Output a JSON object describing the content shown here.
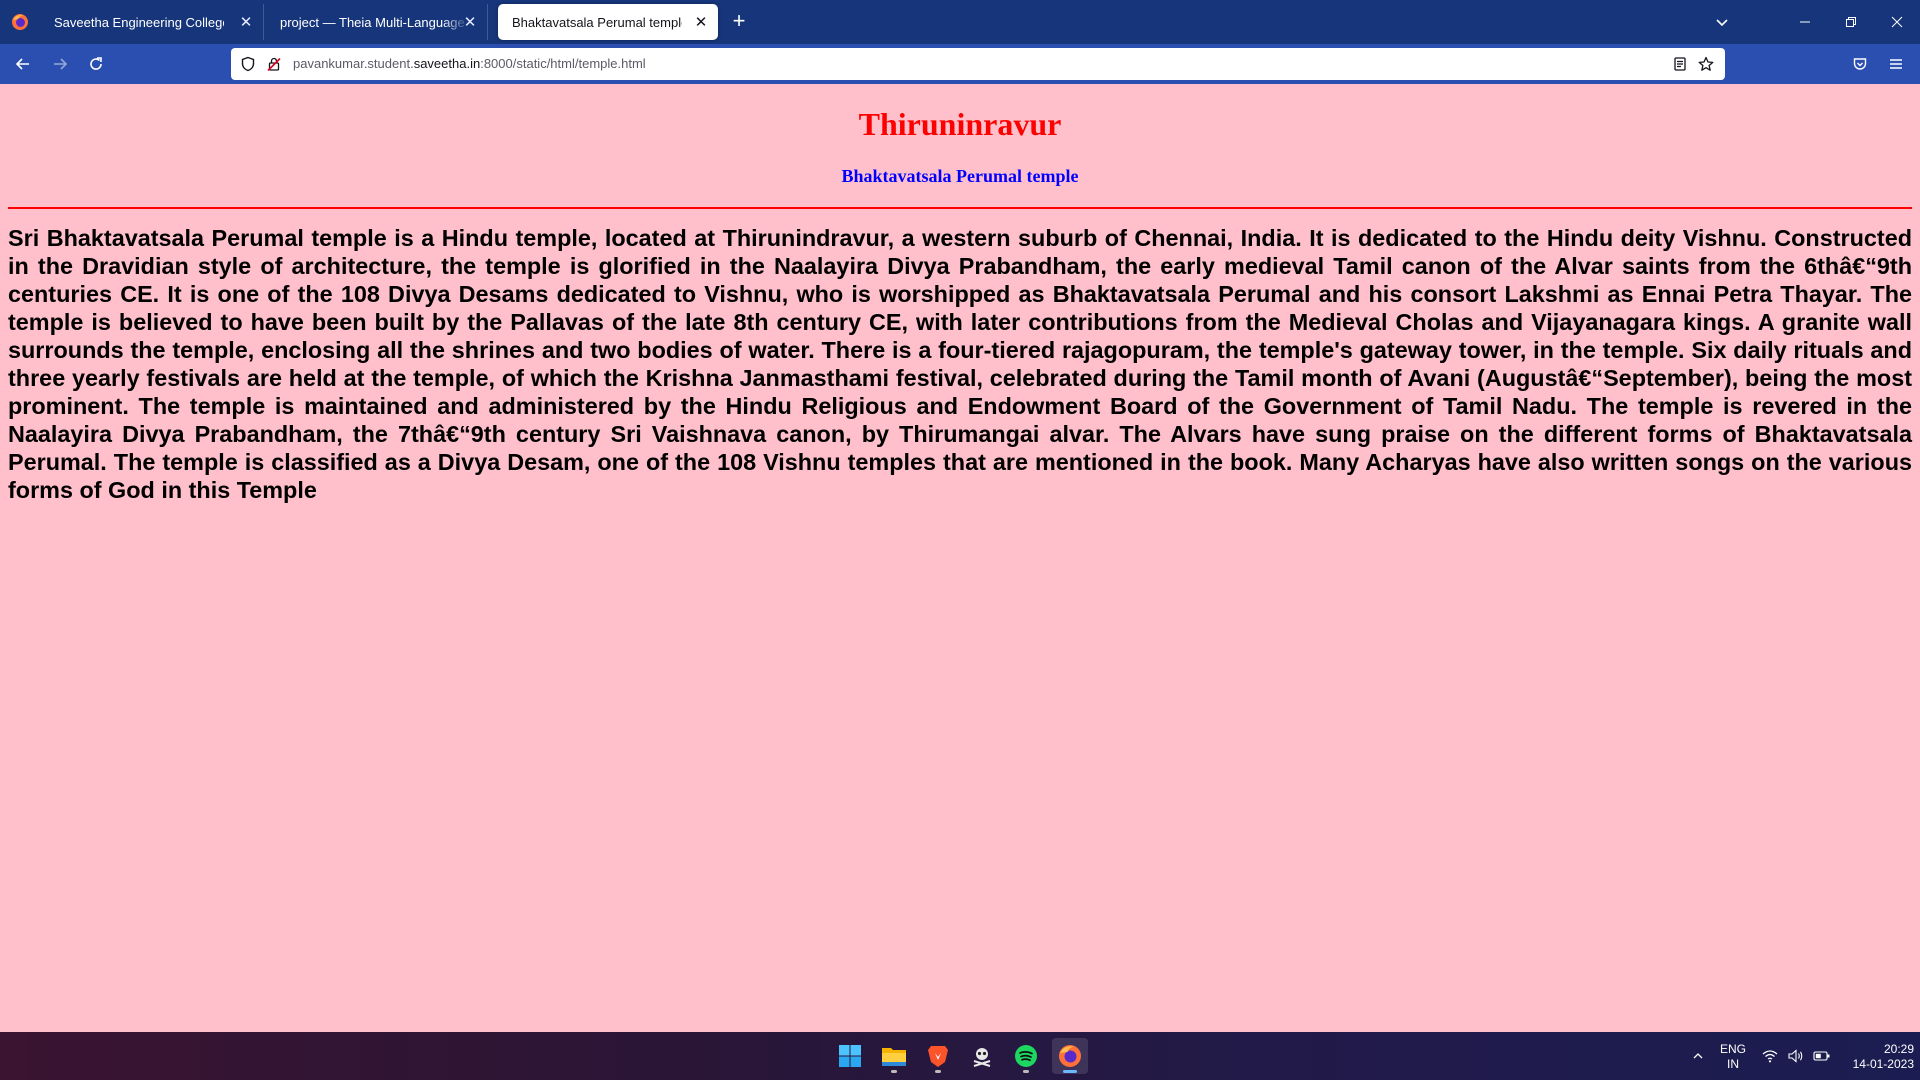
{
  "browser": {
    "tabs": [
      {
        "title": "Saveetha Engineering College",
        "active": false
      },
      {
        "title": "project — Theia Multi-Language Explorer",
        "active": false
      },
      {
        "title": "Bhaktavatsala Perumal temple",
        "active": true
      }
    ],
    "url": {
      "prefix": "pavankumar.student.",
      "domain": "saveetha.in",
      "suffix": ":8000/static/html/temple.html"
    }
  },
  "page": {
    "title": "Thiruninravur",
    "subtitle": "Bhaktavatsala Perumal temple",
    "body": "Sri Bhaktavatsala Perumal temple is a Hindu temple, located at Thirunindravur, a western suburb of Chennai, India. It is dedicated to the Hindu deity Vishnu. Constructed in the Dravidian style of architecture, the temple is glorified in the Naalayira Divya Prabandham, the early medieval Tamil canon of the Alvar saints from the 6thâ€“9th centuries CE. It is one of the 108 Divya Desams dedicated to Vishnu, who is worshipped as Bhaktavatsala Perumal and his consort Lakshmi as Ennai Petra Thayar. The temple is believed to have been built by the Pallavas of the late 8th century CE, with later contributions from the Medieval Cholas and Vijayanagara kings. A granite wall surrounds the temple, enclosing all the shrines and two bodies of water. There is a four-tiered rajagopuram, the temple's gateway tower, in the temple. Six daily rituals and three yearly festivals are held at the temple, of which the Krishna Janmasthami festival, celebrated during the Tamil month of Avani (Augustâ€“September), being the most prominent. The temple is maintained and administered by the Hindu Religious and Endowment Board of the Government of Tamil Nadu. The temple is revered in the Naalayira Divya Prabandham, the 7thâ€“9th century Sri Vaishnava canon, by Thirumangai alvar. The Alvars have sung praise on the different forms of Bhaktavatsala Perumal. The temple is classified as a Divya Desam, one of the 108 Vishnu temples that are mentioned in the book. Many Acharyas have also written songs on the various forms of God in this Temple"
  },
  "colors": {
    "page_background": "#ffc0cb",
    "title": "#ff0000",
    "subtitle": "#0000ff",
    "rule": "#ff0000",
    "tabstrip": "#16357a",
    "navbar": "#2b4fb0"
  },
  "taskbar": {
    "apps": [
      "windows-start-icon",
      "file-explorer-icon",
      "brave-icon",
      "game-icon",
      "spotify-icon",
      "firefox-icon"
    ],
    "lang_line1": "ENG",
    "lang_line2": "IN",
    "time": "20:29",
    "date": "14-01-2023"
  }
}
